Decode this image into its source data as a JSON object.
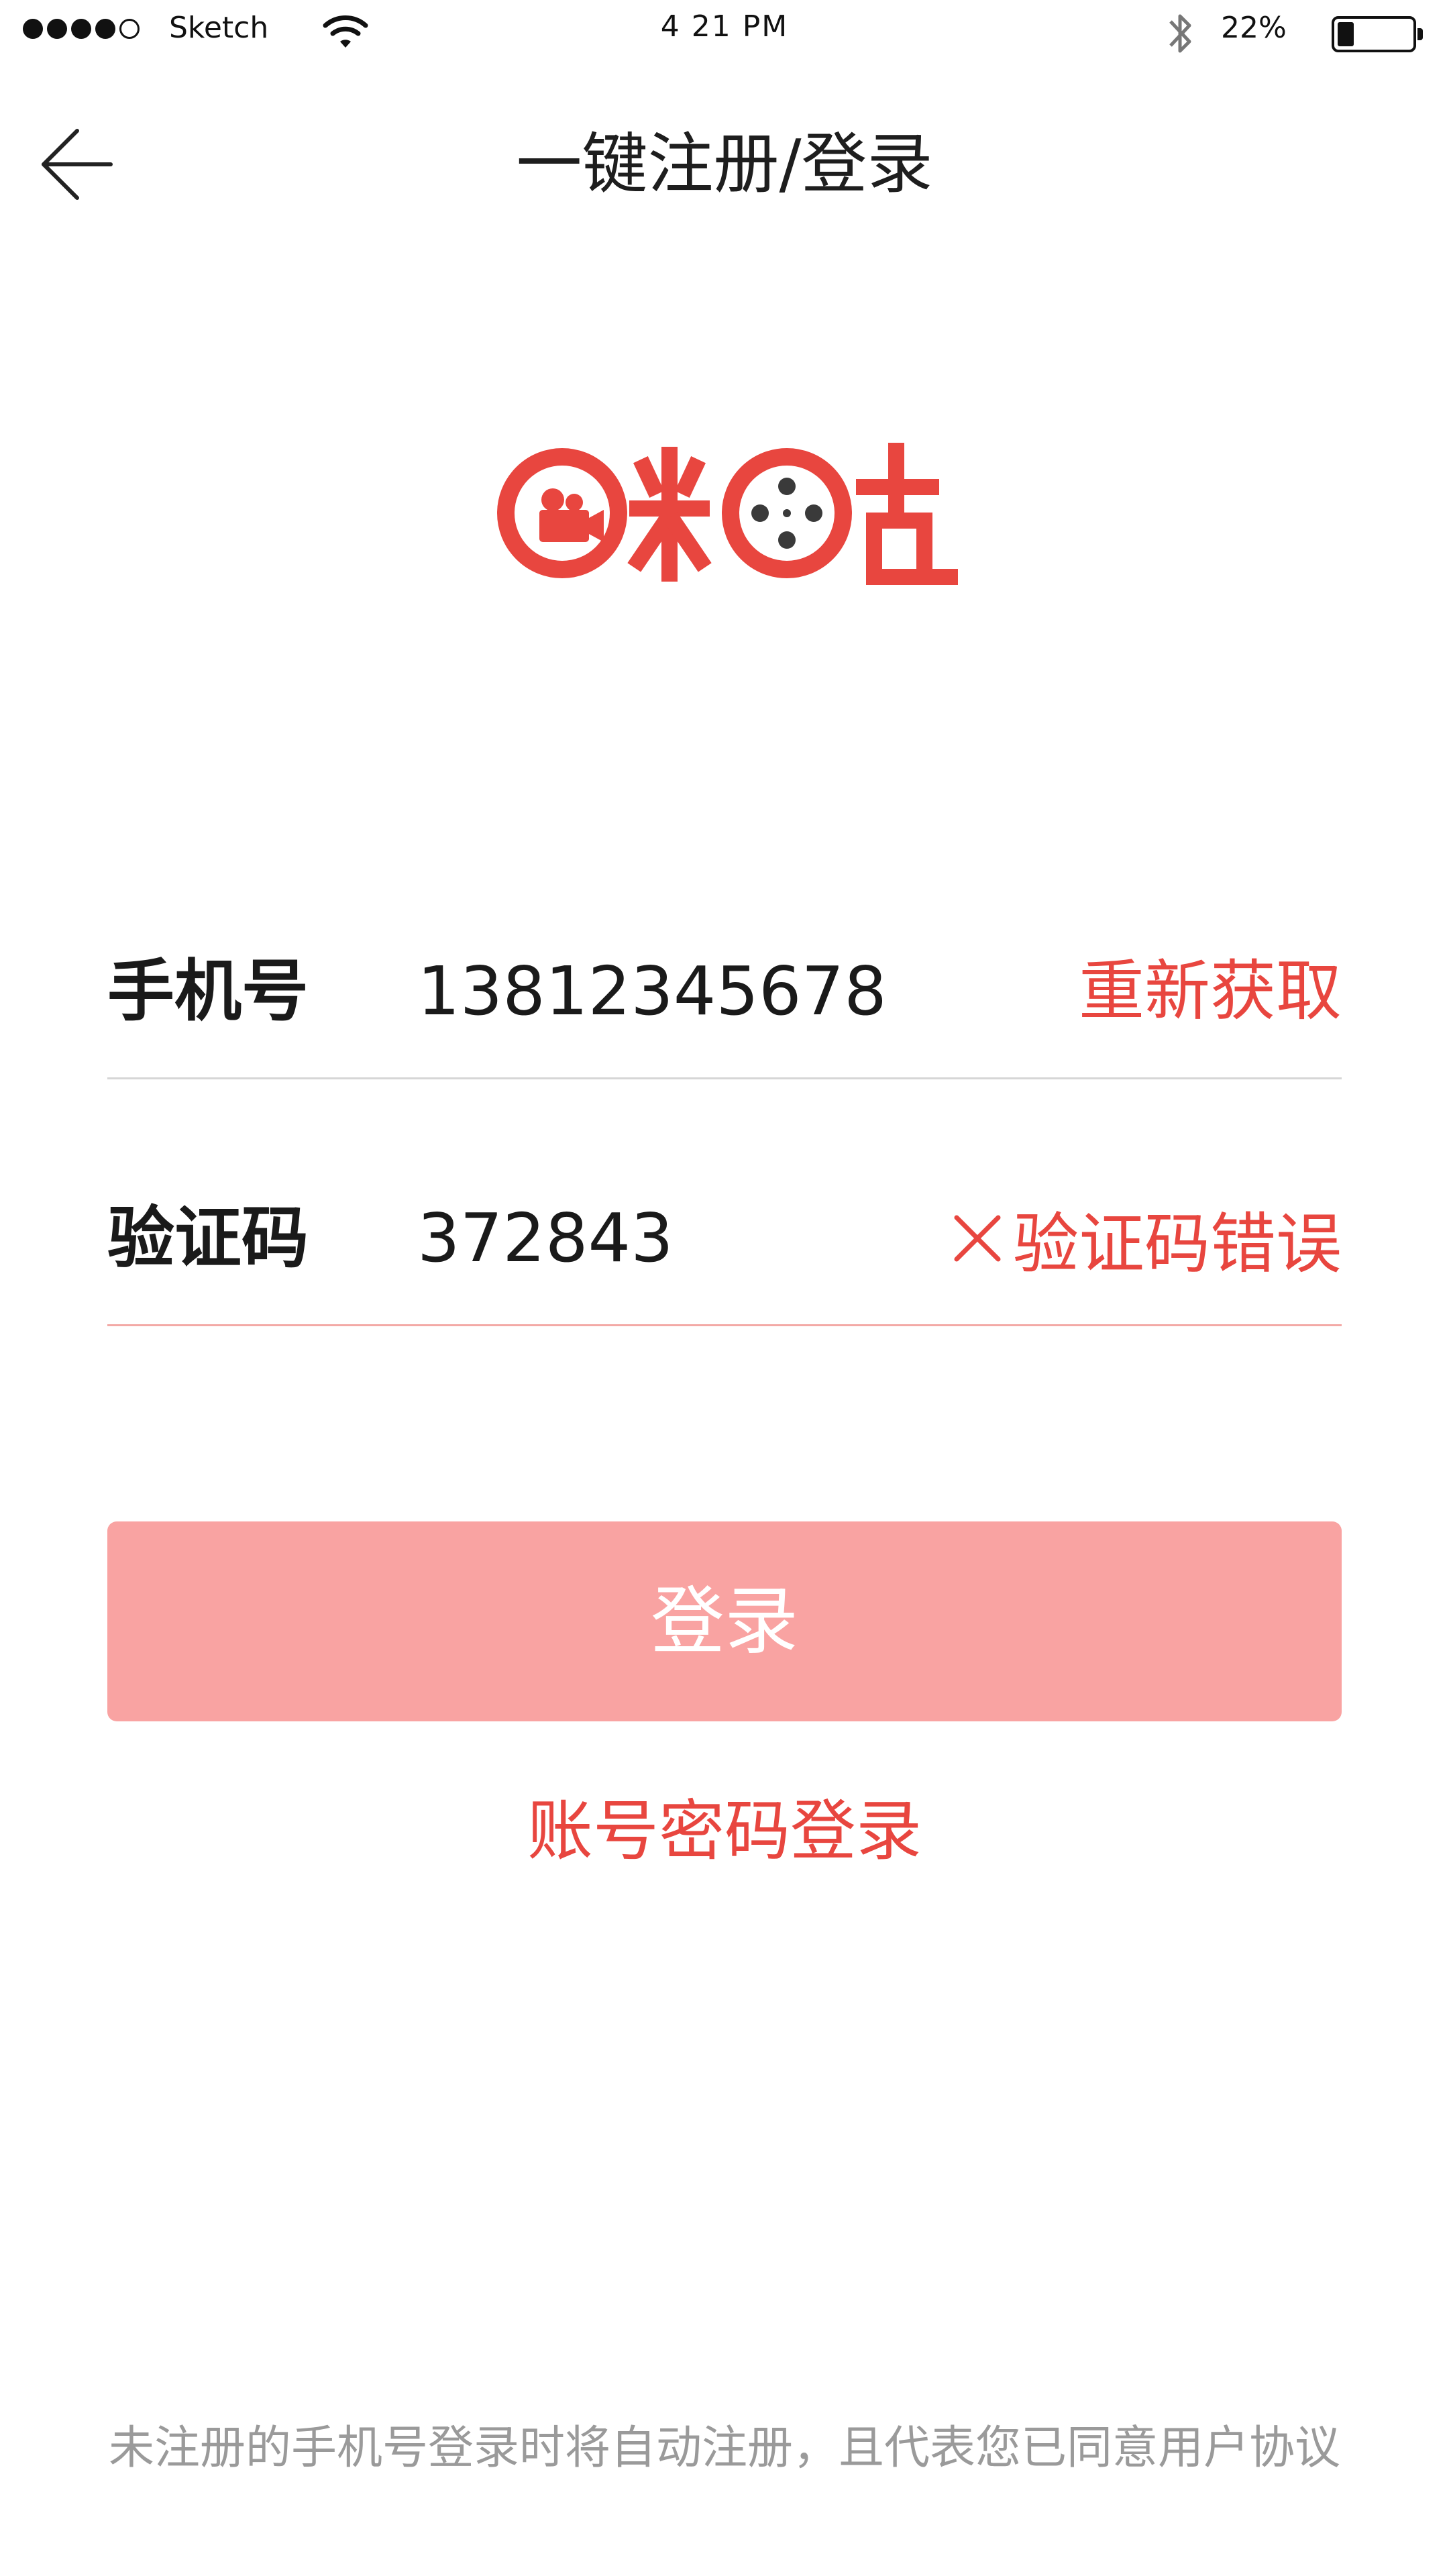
{
  "status_bar": {
    "carrier": "Sketch",
    "time": "4 21 PM",
    "battery_percent": "22%",
    "battery_level": 0.22,
    "signal_bars_filled": 4,
    "signal_bars_total": 5,
    "icons": [
      "wifi-icon",
      "bluetooth-icon",
      "battery-icon"
    ]
  },
  "nav": {
    "title": "一键注册/登录",
    "back_icon": "arrow-left-icon"
  },
  "logo": {
    "text": "咪咕",
    "brand_color": "#e8463f"
  },
  "form": {
    "phone": {
      "label": "手机号",
      "value": "13812345678",
      "action": "重新获取"
    },
    "code": {
      "label": "验证码",
      "value": "372843",
      "error": "验证码错误",
      "error_icon": "close-x-icon"
    }
  },
  "buttons": {
    "login": "登录",
    "password_login": "账号密码登录"
  },
  "footer": {
    "prefix": "未注册的手机号登录时将自动注册，且代表您已同意",
    "link": "用户协议"
  },
  "colors": {
    "accent": "#e8463f",
    "login_button_bg": "#f9a3a2",
    "divider": "#d6d6d6",
    "error_divider": "#f3a9a6",
    "footer_text": "#9a9a9a"
  }
}
